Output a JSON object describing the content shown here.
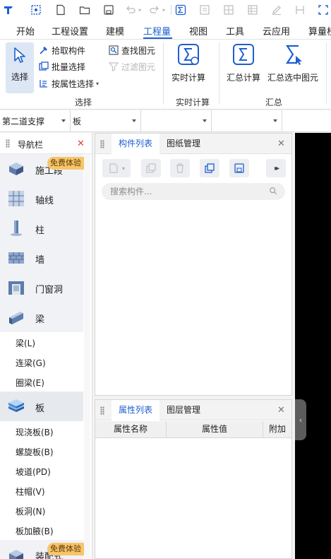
{
  "tabs": [
    "开始",
    "工程设置",
    "建模",
    "工程量",
    "视图",
    "工具",
    "云应用",
    "算量校"
  ],
  "active_tab": "工程量",
  "accent_color": "#1e5fd0",
  "ribbon": {
    "select": {
      "big_button": "选择",
      "pick": "拾取构件",
      "batch": "批量选择",
      "by_attr": "按属性选择",
      "find": "查找图元",
      "filter": "过滤图元",
      "group": "选择"
    },
    "realtime": {
      "button": "实时计算",
      "group": "实时计算"
    },
    "summary": {
      "calc": "汇总计算",
      "calc_selected": "汇总选中图元",
      "group": "汇总"
    }
  },
  "selectors": {
    "floor": "第二道支撑",
    "type": "板",
    "third": "",
    "fourth": ""
  },
  "nav": {
    "title": "导航栏",
    "badge": "免费体验",
    "categories": [
      {
        "label": "施工段",
        "icon": "construction-segment-icon"
      },
      {
        "label": "轴线",
        "icon": "axis-grid-icon"
      },
      {
        "label": "柱",
        "icon": "column-icon"
      },
      {
        "label": "墙",
        "icon": "wall-icon"
      },
      {
        "label": "门窗洞",
        "icon": "door-window-icon"
      },
      {
        "label": "梁",
        "icon": "beam-icon"
      }
    ],
    "beam_items": [
      "梁(L)",
      "连梁(G)",
      "圈梁(E)"
    ],
    "slab": {
      "label": "板",
      "icon": "slab-icon"
    },
    "slab_items": [
      "现浇板(B)",
      "螺旋板(B)",
      "坡道(PD)",
      "柱帽(V)",
      "板洞(N)",
      "板加腋(B)"
    ],
    "decoration": {
      "label": "装配式",
      "icon": "decoration-icon"
    }
  },
  "component_panel": {
    "tabs": [
      "构件列表",
      "图纸管理"
    ],
    "search_placeholder": "搜索构件..."
  },
  "property_panel": {
    "tabs": [
      "属性列表",
      "图层管理"
    ],
    "columns": [
      "属性名称",
      "属性值",
      "附加"
    ]
  }
}
